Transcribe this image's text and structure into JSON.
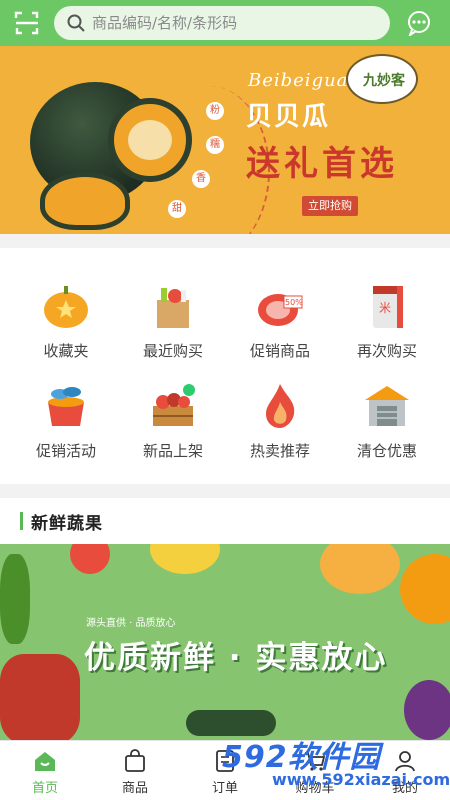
{
  "header": {
    "search_placeholder": "商品编码/名称/条形码",
    "accent": "#6cc765"
  },
  "banner": {
    "en_title": "Beibeigua",
    "cn_title": "贝贝瓜",
    "headline": "送礼首选",
    "button": "立即抢购",
    "brand": "九妙客",
    "taste_labels": [
      "粉",
      "糯",
      "香",
      "甜"
    ]
  },
  "categories": [
    {
      "label": "收藏夹",
      "icon": "pumpkin-star-icon"
    },
    {
      "label": "最近购买",
      "icon": "grocery-bag-icon"
    },
    {
      "label": "促销商品",
      "icon": "meat-discount-icon"
    },
    {
      "label": "再次购买",
      "icon": "rice-bag-icon"
    },
    {
      "label": "促销活动",
      "icon": "fish-bucket-icon"
    },
    {
      "label": "新品上架",
      "icon": "fruit-crate-icon"
    },
    {
      "label": "热卖推荐",
      "icon": "fire-icon"
    },
    {
      "label": "清仓优惠",
      "icon": "warehouse-icon"
    }
  ],
  "section": {
    "title": "新鲜蔬果",
    "banner_sub": "源头直供 · 品质放心",
    "banner_title": "优质新鲜 · 实惠放心"
  },
  "nav": [
    {
      "label": "首页",
      "icon": "home-icon",
      "active": true
    },
    {
      "label": "商品",
      "icon": "bag-icon",
      "active": false
    },
    {
      "label": "订单",
      "icon": "order-icon",
      "active": false
    },
    {
      "label": "购物车",
      "icon": "cart-icon",
      "active": false
    },
    {
      "label": "我的",
      "icon": "user-icon",
      "active": false
    }
  ],
  "watermark": {
    "brand": "592软件园",
    "url": "www.592xiazai.com"
  }
}
